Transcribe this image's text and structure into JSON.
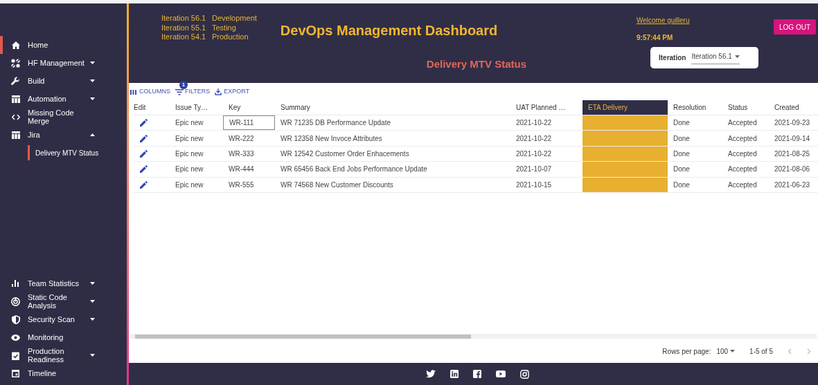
{
  "sidebar": {
    "items": [
      {
        "label": "Home",
        "selected": true,
        "expandable": false
      },
      {
        "label": "HF Management",
        "selected": false,
        "expandable": true,
        "expanded": false
      },
      {
        "label": "Build",
        "selected": false,
        "expandable": true,
        "expanded": false
      },
      {
        "label": "Automation",
        "selected": false,
        "expandable": true,
        "expanded": false
      },
      {
        "label": "Missing Code Merge",
        "selected": false,
        "expandable": false
      },
      {
        "label": "Jira",
        "selected": false,
        "expandable": true,
        "expanded": true,
        "children": [
          {
            "label": "Delivery MTV Status",
            "selected": true
          }
        ]
      }
    ],
    "bottom_items": [
      {
        "label": "Team Statistics",
        "selected": false,
        "expandable": true,
        "expanded": false
      },
      {
        "label": "Static Code Analysis",
        "selected": false,
        "expandable": true,
        "expanded": false
      },
      {
        "label": "Security Scan",
        "selected": false,
        "expandable": true,
        "expanded": false
      },
      {
        "label": "Monitoring",
        "selected": false,
        "expandable": false
      },
      {
        "label": "Production Readiness",
        "selected": false,
        "expandable": true,
        "expanded": false
      },
      {
        "label": "Timeline",
        "selected": false,
        "expandable": false
      }
    ]
  },
  "header": {
    "iterations": [
      {
        "iteration": "Iteration 56.1",
        "stage": "Development"
      },
      {
        "iteration": "Iteration 55.1",
        "stage": "Testing"
      },
      {
        "iteration": "Iteration 54.1",
        "stage": "Production"
      }
    ],
    "title": "DevOps Management Dashboard",
    "subtitle": "Delivery MTV Status",
    "welcome": "Welcome guilleru",
    "time": "9:57:44 PM",
    "logout": "LOG OUT",
    "iteration_select": {
      "label": "Iteration",
      "value": "Iteration 56.1"
    }
  },
  "toolbar": {
    "columns": "COLUMNS",
    "filters": "FILTERS",
    "filter_count": "1",
    "export": "EXPORT"
  },
  "table": {
    "columns": [
      {
        "label": "Edit",
        "highlighted": false
      },
      {
        "label": "Issue Ty…",
        "highlighted": false
      },
      {
        "label": "Key",
        "highlighted": false
      },
      {
        "label": "Summary",
        "highlighted": false
      },
      {
        "label": "UAT Planned …",
        "highlighted": false
      },
      {
        "label": "ETA Delivery",
        "highlighted": true
      },
      {
        "label": "Resolution",
        "highlighted": false
      },
      {
        "label": "Status",
        "highlighted": false
      },
      {
        "label": "Created",
        "highlighted": false
      }
    ],
    "rows": [
      {
        "issue_type": "Epic new",
        "key": "WR-111",
        "key_focused": true,
        "summary": "WR 71235 DB Performance Update",
        "uat_planned": "2021-10-22",
        "resolution": "Done",
        "status": "Accepted",
        "created": "2021-09-23"
      },
      {
        "issue_type": "Epic new",
        "key": "WR-222",
        "key_focused": false,
        "summary": "WR 12358 New Invoce Attributes",
        "uat_planned": "2021-10-22",
        "resolution": "Done",
        "status": "Accepted",
        "created": "2021-09-14"
      },
      {
        "issue_type": "Epic new",
        "key": "WR-333",
        "key_focused": false,
        "summary": "WR 12542 Customer Order Enhacements",
        "uat_planned": "2021-10-22",
        "resolution": "Done",
        "status": "Accepted",
        "created": "2021-08-25"
      },
      {
        "issue_type": "Epic new",
        "key": "WR-444",
        "key_focused": false,
        "summary": "WR 65456 Back End Jobs Performance Update",
        "uat_planned": "2021-10-07",
        "resolution": "Done",
        "status": "Accepted",
        "created": "2021-08-06"
      },
      {
        "issue_type": "Epic new",
        "key": "WR-555",
        "key_focused": false,
        "summary": "WR 74568 New Customer Discounts",
        "uat_planned": "2021-10-15",
        "resolution": "Done",
        "status": "Accepted",
        "created": "2021-06-23"
      }
    ]
  },
  "pagination": {
    "rows_per_page_label": "Rows per page:",
    "rows_per_page": "100",
    "range": "1-5 of 5"
  }
}
